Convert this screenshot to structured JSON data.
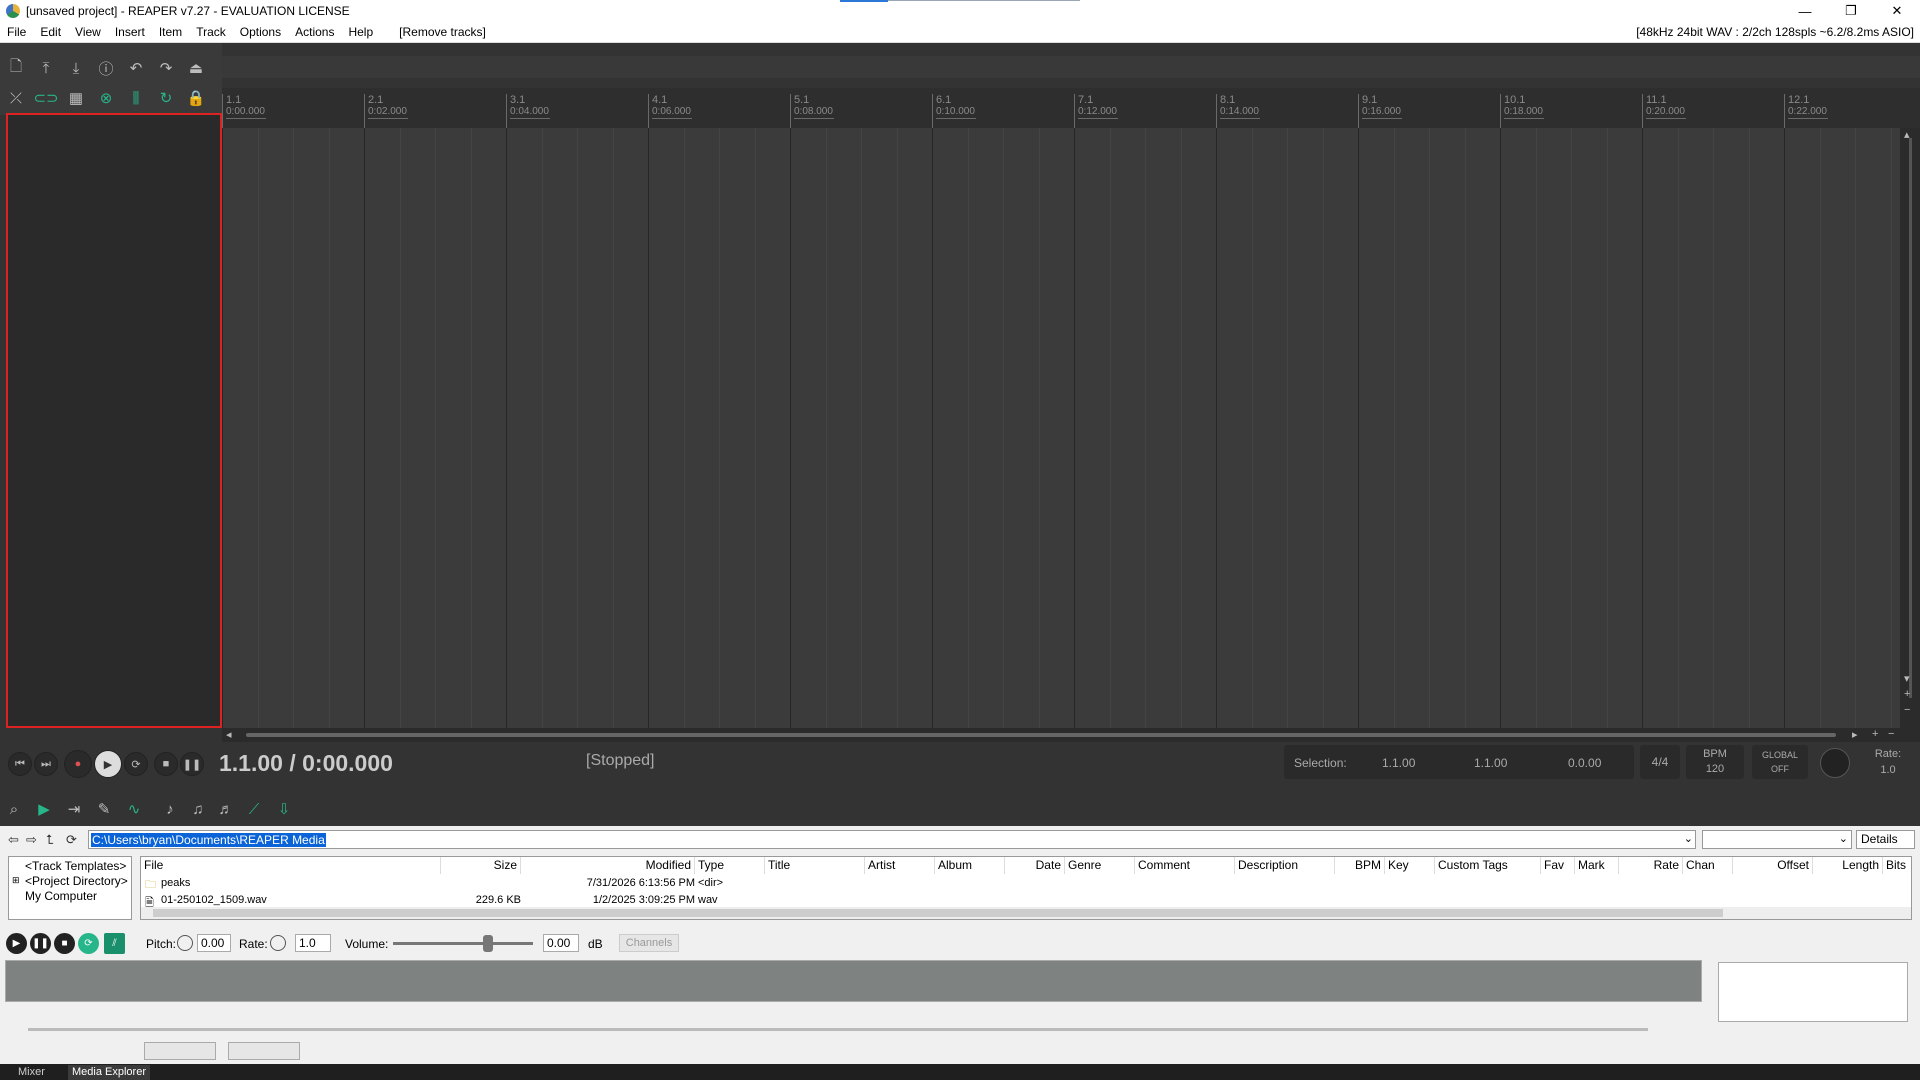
{
  "window": {
    "title": "[unsaved project] - REAPER v7.27 - EVALUATION LICENSE",
    "controls": {
      "minimize": "—",
      "maximize": "❐",
      "close": "✕"
    }
  },
  "menubar": {
    "items": [
      "File",
      "Edit",
      "View",
      "Insert",
      "Item",
      "Track",
      "Options",
      "Actions",
      "Help"
    ],
    "remove_tracks": "[Remove tracks]",
    "audio_status": "[48kHz 24bit WAV : 2/2ch 128spls ~6.2/8.2ms ASIO]"
  },
  "ruler": {
    "marks": [
      {
        "bar": "1.1",
        "time": "0:00.000"
      },
      {
        "bar": "2.1",
        "time": "0:02.000"
      },
      {
        "bar": "3.1",
        "time": "0:04.000"
      },
      {
        "bar": "4.1",
        "time": "0:06.000"
      },
      {
        "bar": "5.1",
        "time": "0:08.000"
      },
      {
        "bar": "6.1",
        "time": "0:10.000"
      },
      {
        "bar": "7.1",
        "time": "0:12.000"
      },
      {
        "bar": "8.1",
        "time": "0:14.000"
      },
      {
        "bar": "9.1",
        "time": "0:16.000"
      },
      {
        "bar": "10.1",
        "time": "0:18.000"
      },
      {
        "bar": "11.1",
        "time": "0:20.000"
      },
      {
        "bar": "12.1",
        "time": "0:22.000"
      }
    ]
  },
  "transport": {
    "position": "1.1.00 / 0:00.000",
    "state": "[Stopped]",
    "selection_label": "Selection:",
    "selection_start": "1.1.00",
    "selection_end": "1.1.00",
    "selection_length": "0.0.00",
    "time_signature": "4/4",
    "bpm_label": "BPM",
    "bpm_value": "120",
    "global_label": "GLOBAL",
    "global_value": "OFF",
    "rate_label": "Rate:",
    "rate_value": "1.0"
  },
  "media_explorer": {
    "path": "C:\\Users\\bryan\\Documents\\REAPER Media",
    "view_mode": "Details",
    "tree": [
      "<Track Templates>",
      "<Project Directory>",
      "My Computer"
    ],
    "columns": [
      "File",
      "Size",
      "Modified",
      "Type",
      "Title",
      "Artist",
      "Album",
      "Date",
      "Genre",
      "Comment",
      "Description",
      "BPM",
      "Key",
      "Custom Tags",
      "Fav",
      "Mark",
      "Rate",
      "Chan",
      "Offset",
      "Length",
      "Bits"
    ],
    "rows": [
      {
        "file": "peaks",
        "size": "",
        "modified": "7/31/2026 6:13:56 PM",
        "type": "<dir>"
      },
      {
        "file": "01-250102_1509.wav",
        "size": "229.6 KB",
        "modified": "1/2/2025 3:09:25 PM",
        "type": "wav"
      }
    ],
    "preview": {
      "pitch_label": "Pitch:",
      "pitch_value": "0.00",
      "rate_label": "Rate:",
      "rate_value": "1.0",
      "volume_label": "Volume:",
      "volume_value": "0.00",
      "volume_unit": "dB",
      "volume_level_fraction": 0.68,
      "channels_label": "Channels"
    }
  },
  "dock_tabs": [
    {
      "label": "Mixer",
      "active": false
    },
    {
      "label": "Media Explorer",
      "active": true
    }
  ],
  "colors": {
    "arrange_bg": "#3b3b3b",
    "accent_green": "#27b58a",
    "tcp_border": "#dd2222",
    "path_highlight": "#0a64d8"
  }
}
